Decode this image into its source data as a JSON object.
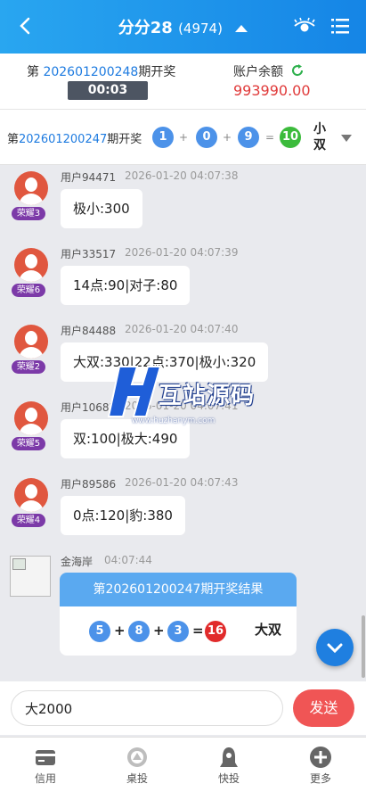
{
  "header": {
    "title": "分分28",
    "count": "(4974)",
    "colors": {
      "start": "#29a6f0",
      "end": "#1585e6"
    },
    "icons": [
      "back-arrow-icon",
      "expand-up-icon",
      "eye-icon",
      "menu-list-icon"
    ]
  },
  "current": {
    "prefix": "第",
    "issue": "202601200248",
    "suffix": "期开奖",
    "countdown": "00:03",
    "balance_label": "账户余额",
    "balance": "993990.00"
  },
  "last": {
    "prefix": "第",
    "issue": "202601200247",
    "suffix": "期开奖",
    "balls": [
      "1",
      "0",
      "9"
    ],
    "plus": "+",
    "eq": "=",
    "sum": "10",
    "tag": "小双"
  },
  "messages": [
    {
      "badge": "荣耀3",
      "user": "用户94471",
      "time": "2026-01-20 04:07:38",
      "text": "极小:300"
    },
    {
      "badge": "荣耀6",
      "user": "用户33517",
      "time": "2026-01-20 04:07:39",
      "text": "14点:90|对子:80"
    },
    {
      "badge": "荣耀2",
      "user": "用户84488",
      "time": "2026-01-20 04:07:40",
      "text": "大双:330|22点:370|极小:320"
    },
    {
      "badge": "荣耀5",
      "user": "用户10683",
      "time": "2026-01-20 04:07:41",
      "text": "双:100|极大:490"
    },
    {
      "badge": "荣耀4",
      "user": "用户89586",
      "time": "2026-01-20 04:07:43",
      "text": "0点:120|豹:380"
    }
  ],
  "system": {
    "name": "金海岸",
    "time": "04:07:44",
    "card_title": "第202601200247期开奖结果",
    "balls": [
      "5",
      "8",
      "3"
    ],
    "plus": "+",
    "eq": "=",
    "sum": "16",
    "result": "大双"
  },
  "watermark": {
    "text": "互站源码",
    "url": "www.huzhanym.com"
  },
  "input": {
    "value": "大2000",
    "send": "发送"
  },
  "tabs": [
    {
      "label": "信用",
      "icon": "credit-card-icon"
    },
    {
      "label": "桌投",
      "icon": "table-bet-icon"
    },
    {
      "label": "快投",
      "icon": "quick-bet-icon"
    },
    {
      "label": "更多",
      "icon": "more-plus-icon"
    }
  ]
}
